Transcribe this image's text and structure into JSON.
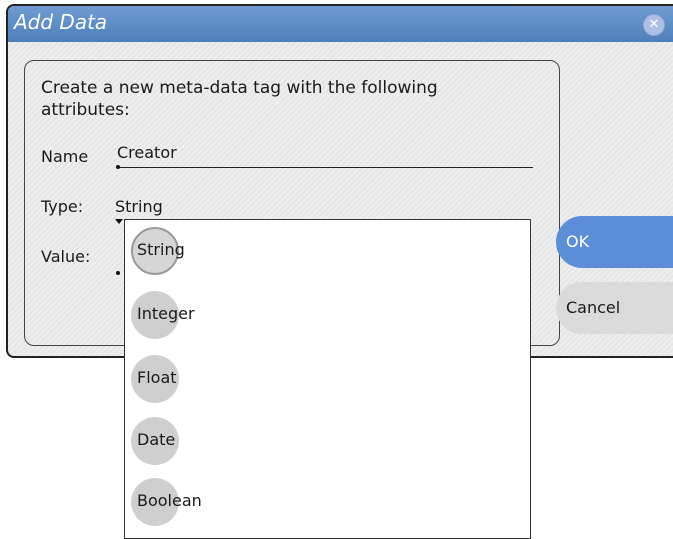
{
  "dialog": {
    "title": "Add Data",
    "close_icon": "close-icon",
    "description": "Create a new meta-data tag with the following attributes:",
    "name_label": "Name",
    "name_value": "Creator",
    "type_label": "Type:",
    "type_value": "String",
    "value_label": "Value:",
    "value_value": "",
    "ok_label": "OK",
    "cancel_label": "Cancel"
  },
  "dropdown": {
    "options": [
      "String",
      "Integer",
      "Float",
      "Date",
      "Boolean"
    ],
    "selected": "String"
  },
  "colors": {
    "titlebar": "#5b8ed6",
    "ok_button": "#5b8ed6",
    "cancel_button": "#dadada"
  }
}
